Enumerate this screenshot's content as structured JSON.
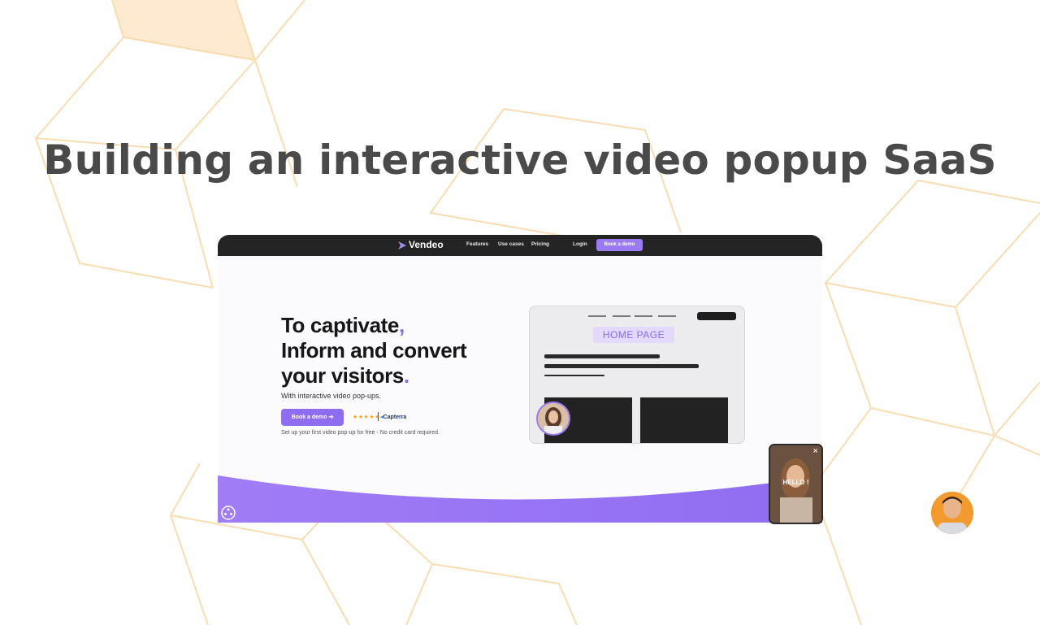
{
  "page": {
    "title": "Building an interactive video popup SaaS"
  },
  "site": {
    "logo_text": "Vendeo",
    "nav": [
      "Features",
      "Use cases",
      "Pricing"
    ],
    "login": "Login",
    "cta": "Book a demo"
  },
  "hero": {
    "line1": "To captivate",
    "line2": "Inform and convert",
    "line3": "your visitors",
    "punct1": ",",
    "punct3": ".",
    "subtitle": "With interactive video pop-ups.",
    "button": "Book a demo ➔",
    "rating_stars": "★★★★★",
    "rating_brand": "Capterra",
    "note": "Set up your first video pop-up for free - No credit card required."
  },
  "mockup": {
    "label": "HOME PAGE"
  },
  "popup": {
    "close": "×",
    "greeting": "HELLO !"
  },
  "colors": {
    "accent": "#8f6df0",
    "title": "#4a4a4a",
    "nav_bg": "#242424",
    "background_lines": "#f8d7a4"
  },
  "icons": [
    "vendeo-logo-icon",
    "arrow-right-icon",
    "capterra-icon",
    "close-icon",
    "widget-icon"
  ]
}
